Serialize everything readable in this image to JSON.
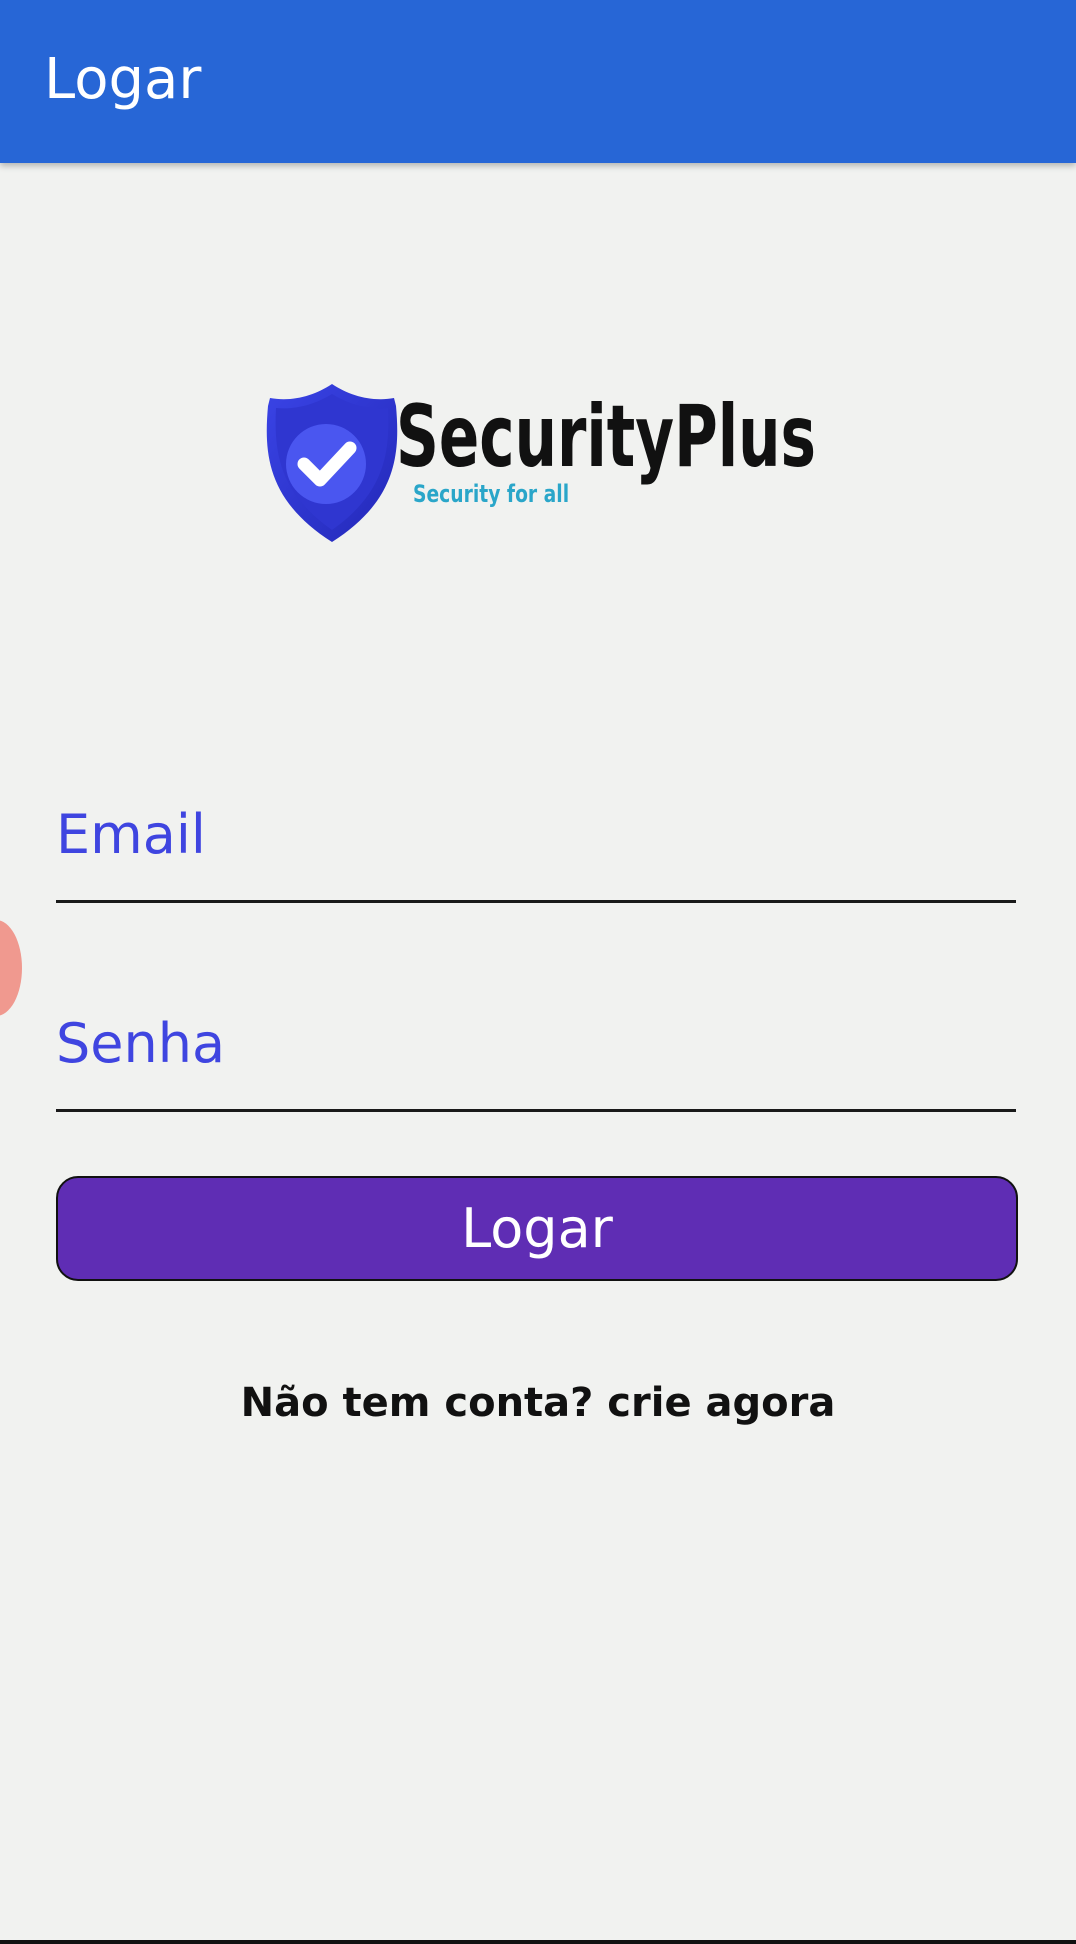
{
  "app_bar": {
    "title": "Logar",
    "color": "#2766d6"
  },
  "logo": {
    "brand_name": "SecurityPlus",
    "tagline": "Security for all",
    "shield_color": "#2f3bd8",
    "check_icon": "check-icon"
  },
  "form": {
    "email_placeholder": "Email",
    "password_placeholder": "Senha",
    "login_label": "Logar",
    "button_color": "#5f2db4",
    "placeholder_color": "#3f45e0"
  },
  "signup_link": "Não tem conta? crie agora"
}
